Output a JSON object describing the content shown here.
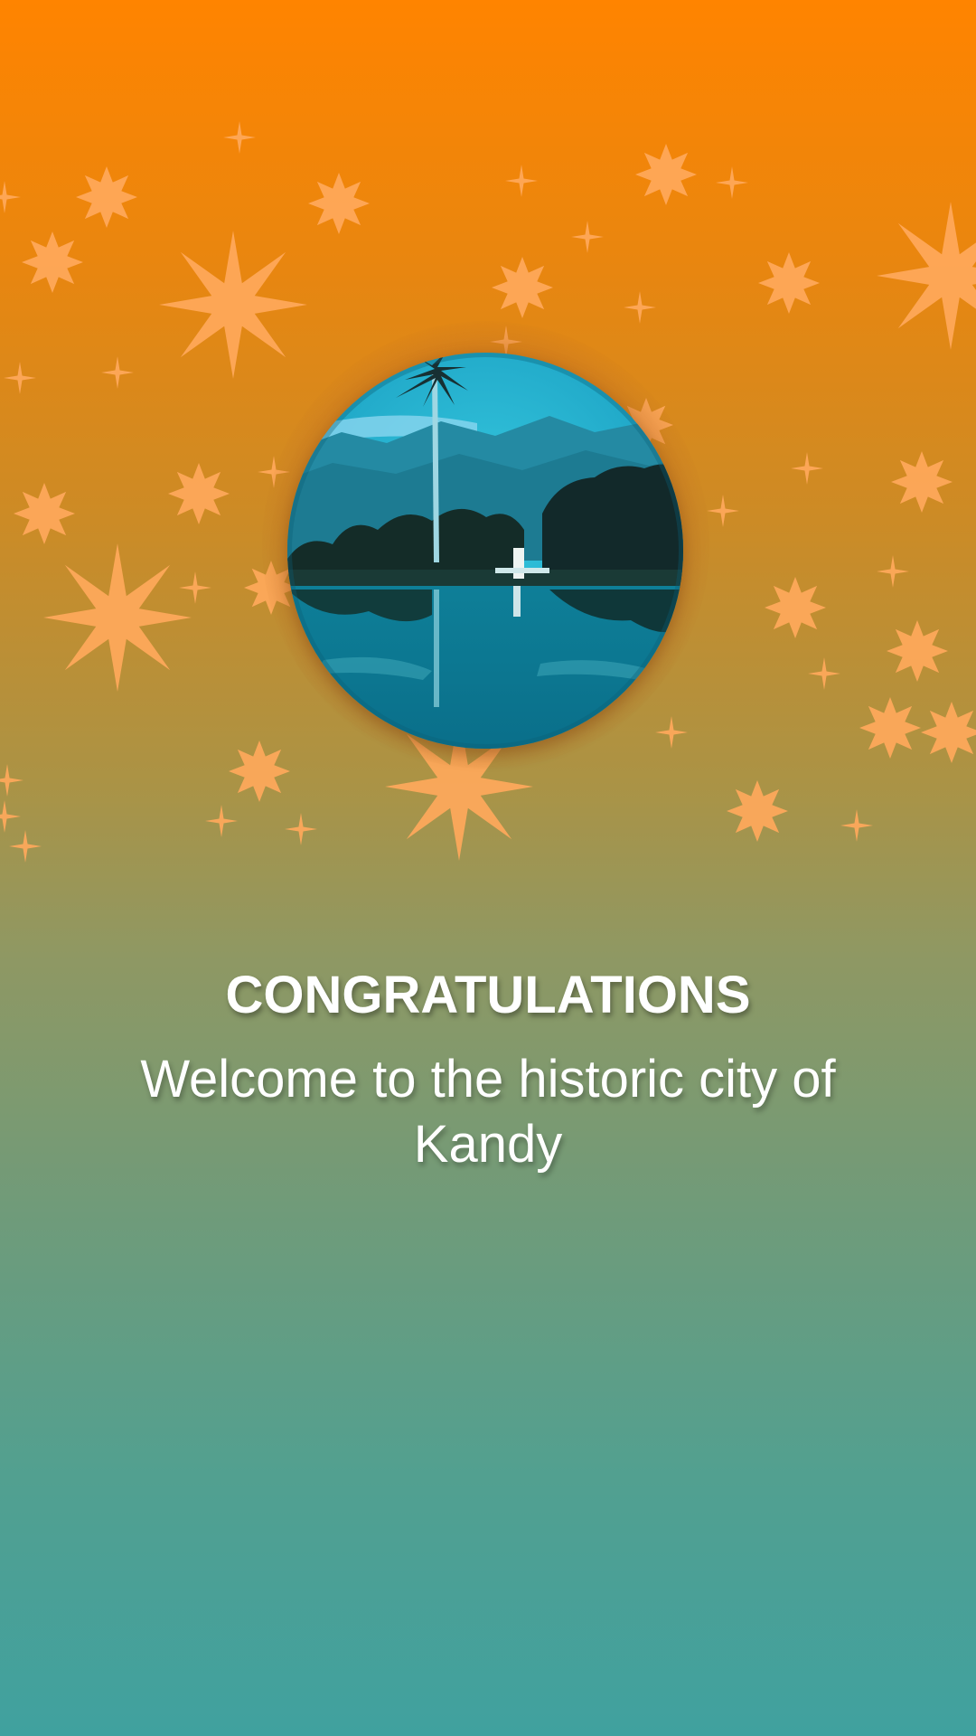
{
  "screen": {
    "title": "CONGRATULATIONS",
    "message": "Welcome to the historic city of Kandy"
  },
  "decoration": {
    "star_color": "#ffa95c",
    "badge_image": "kandy-lake-icon",
    "sparkle_icon": "star-sparkle-icon"
  },
  "colors": {
    "gradient_top": "#ff8400",
    "gradient_bottom": "#40a19f",
    "text": "#ffffff"
  }
}
